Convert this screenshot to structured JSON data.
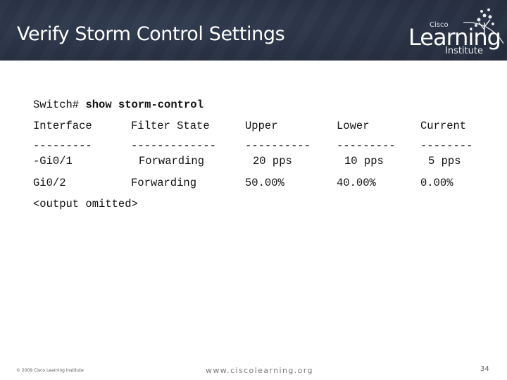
{
  "slide": {
    "title": "Verify Storm Control Settings",
    "logo": {
      "top_text": "Cisco",
      "main_text": "Learning",
      "bottom_text": "Institute"
    }
  },
  "terminal": {
    "prompt": "Switch#",
    "command": "show storm-control",
    "columns": [
      "Interface",
      "Filter State",
      "Upper",
      "Lower",
      "Current"
    ],
    "separators": [
      "---------",
      "-------------",
      "----------",
      "---------",
      "--------"
    ],
    "rows": [
      {
        "interface": "-Gi0/1",
        "filter_state": "Forwarding",
        "upper": "20 pps",
        "lower": "10 pps",
        "current": "5 pps"
      },
      {
        "interface": "Gi0/2",
        "filter_state": "Forwarding",
        "upper": "50.00%",
        "lower": "40.00%",
        "current": "0.00%"
      }
    ],
    "omitted": "<output omitted>"
  },
  "footer": {
    "copyright": "© 2009 Cisco Learning Institute",
    "url": "www.ciscolearning.org",
    "page_number": "34"
  }
}
